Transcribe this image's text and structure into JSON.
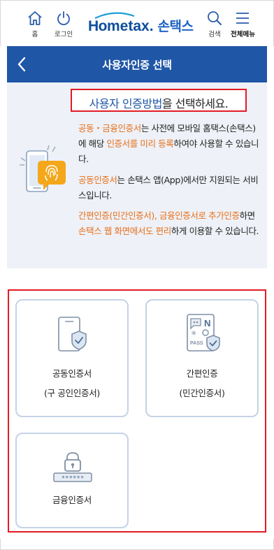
{
  "header": {
    "home_label": "홈",
    "login_label": "로그인",
    "logo_en_part1": "Ho",
    "logo_en_part2": "me",
    "logo_en_part3": "tax.",
    "logo_ko": "손택스",
    "search_label": "검색",
    "menu_label": "전체메뉴"
  },
  "titlebar": {
    "title": "사용자인증 선택"
  },
  "info": {
    "headline_highlight": "사용자 인증방법",
    "headline_rest": "을 선택하세요.",
    "p1": {
      "a_orange": "공동・금융인증서",
      "b": "는 사전에 모바일 홈택스(손택스)에 해당 ",
      "c_orange": "인증서를 미리 등록",
      "d": "하여야 사용할 수 있습니다."
    },
    "p2": {
      "a_orange": "공동인증서",
      "b": "는 손택스 앱(App)에서만 지원되는 서비스입니다."
    },
    "p3": {
      "a_orange": "간편인증(민간인증서), 금융인증서로 추가인증",
      "b": "하면 ",
      "c_orange": "손택스 웹 화면에서도 편리",
      "d": "하게 이용할 수 있습니다."
    }
  },
  "options": [
    {
      "line1": "공동인증서",
      "line2": "(구 공인인증서)"
    },
    {
      "line1": "간편인증",
      "line2": "(민간인증서)"
    },
    {
      "line1": "금융인증서",
      "line2": ""
    }
  ],
  "colors": {
    "brand_blue": "#1f56a6",
    "highlight_orange": "#e8701a",
    "outline_red": "#e21b23",
    "panel_bg": "#eef1f7"
  },
  "icons": {
    "home": "home-icon",
    "login": "power-icon",
    "search": "search-icon",
    "menu": "hamburger-menu-icon",
    "back": "chevron-left-icon"
  }
}
